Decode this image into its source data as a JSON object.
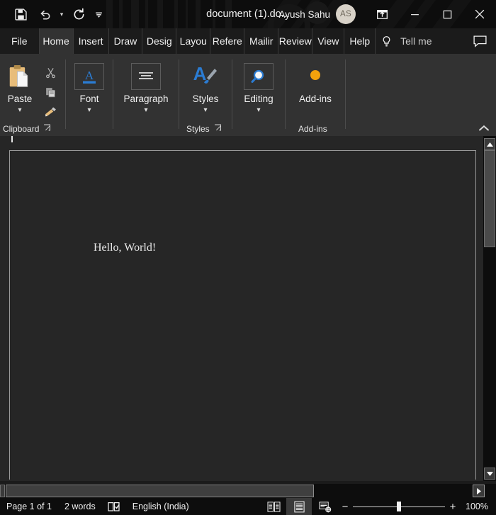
{
  "window": {
    "title": "document (1).do...",
    "account_name": "Ayush Sahu",
    "avatar_initials": "AS",
    "quick_access": [
      {
        "name": "save-icon",
        "label": "Save"
      },
      {
        "name": "undo-icon",
        "label": "Undo"
      },
      {
        "name": "redo-icon",
        "label": "Redo"
      },
      {
        "name": "customize-qat-icon",
        "label": "Customize Quick Access Toolbar"
      }
    ],
    "controls": [
      {
        "name": "ribbon-display-options",
        "label": "Ribbon Display Options"
      },
      {
        "name": "minimize",
        "label": "Minimize"
      },
      {
        "name": "maximize",
        "label": "Maximize"
      },
      {
        "name": "close",
        "label": "Close"
      }
    ]
  },
  "tabs": {
    "file_label": "File",
    "items": [
      {
        "label": "Home",
        "active": true
      },
      {
        "label": "Insert",
        "active": false
      },
      {
        "label": "Draw",
        "active": false
      },
      {
        "label": "Desig",
        "active": false
      },
      {
        "label": "Layou",
        "active": false
      },
      {
        "label": "Refere",
        "active": false
      },
      {
        "label": "Mailir",
        "active": false
      },
      {
        "label": "Review",
        "active": false
      },
      {
        "label": "View",
        "active": false
      },
      {
        "label": "Help",
        "active": false
      }
    ],
    "tell_me": "Tell me",
    "comments_label": "Comments"
  },
  "ribbon": {
    "groups": [
      {
        "name": "clipboard",
        "label": "Clipboard",
        "main_button": {
          "label": "Paste",
          "icon": "paste-icon",
          "has_chevron": true
        },
        "small_buttons": [
          {
            "label": "Cut",
            "icon": "cut-icon"
          },
          {
            "label": "Copy",
            "icon": "copy-icon"
          },
          {
            "label": "Format Painter",
            "icon": "format-painter-icon"
          }
        ],
        "has_dialog_launcher": true
      },
      {
        "name": "font",
        "label": "",
        "main_button": {
          "label": "Font",
          "icon": "font-icon",
          "has_chevron": true
        },
        "has_dialog_launcher": false
      },
      {
        "name": "paragraph",
        "label": "",
        "main_button": {
          "label": "Paragraph",
          "icon": "paragraph-icon",
          "has_chevron": true
        },
        "has_dialog_launcher": false
      },
      {
        "name": "styles",
        "label": "Styles",
        "main_button": {
          "label": "Styles",
          "icon": "styles-icon",
          "has_chevron": true
        },
        "has_dialog_launcher": true
      },
      {
        "name": "editing",
        "label": "",
        "main_button": {
          "label": "Editing",
          "icon": "editing-icon",
          "has_chevron": true
        },
        "has_dialog_launcher": false
      },
      {
        "name": "addins",
        "label": "Add-ins",
        "main_button": {
          "label": "Add-ins",
          "icon": "addins-icon",
          "has_chevron": false
        },
        "has_dialog_launcher": false
      }
    ],
    "collapse_label": "Collapse the Ribbon"
  },
  "document": {
    "body_text": "Hello, World!"
  },
  "scrollbars": {
    "vertical": {
      "up_label": "Line up",
      "down_label": "Line down"
    },
    "horizontal": {
      "right_label": "Scroll right"
    }
  },
  "statusbar": {
    "page": "Page 1 of 1",
    "words": "2 words",
    "proofing_icon": "proofing-icon",
    "language": "English (India)",
    "views": [
      {
        "name": "read-mode",
        "label": "Read Mode",
        "active": false
      },
      {
        "name": "print-layout",
        "label": "Print Layout",
        "active": true
      },
      {
        "name": "web-layout",
        "label": "Web Layout",
        "active": false
      }
    ],
    "zoom_out": "−",
    "zoom_in": "+",
    "zoom_level": "100%"
  },
  "colors": {
    "titlebar_bg": "#0d0d0d",
    "ribbon_bg": "#323232",
    "doc_bg": "#262626",
    "accent_blue": "#2b7cd3",
    "accent_orange": "#f2a20c",
    "paste_tan": "#e8bd7a"
  }
}
